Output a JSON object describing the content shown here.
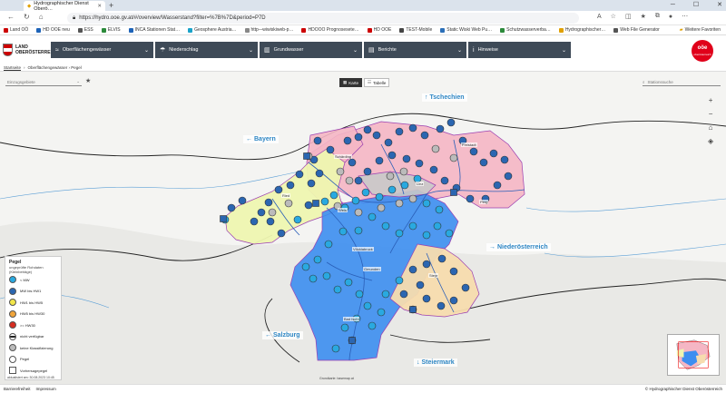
{
  "browser": {
    "tab_title": "Hydrographischer Dienst Oberö…",
    "url": "https://hydro.ooe.gv.at/#/overview/Wasserstand?filter=%7B%7D&period=P7D",
    "bookmarks": [
      "Land OÖ",
      "HD OOE neu",
      "ESS",
      "ELVIS",
      "INCA Stationen Stat…",
      "Geosphere Austria…",
      "http-–wiwiskiweb-p…",
      "HDOOO Prognosesete…",
      "HD OOE",
      "TEST-Mobile",
      "Static Wiski Web Pu…",
      "Schutzwasserverba…",
      "Hydrographischer…",
      "Web File Generator"
    ],
    "bookmarks_folder": "Weitere Favoriten"
  },
  "header": {
    "logo_line1": "LAND",
    "logo_line2": "OBERÖSTERREICH",
    "menus": [
      "Oberflächengewässer",
      "Niederschlag",
      "Grundwasser",
      "Berichte",
      "Hinweise"
    ],
    "ooe_logo_line1": "oöe",
    "ooe_logo_line2": "oberösterreich"
  },
  "breadcrumb": [
    "Startseite",
    "Oberflächengewässer › Pegel"
  ],
  "map": {
    "gebiet_placeholder": "Einzugsgebiete",
    "view_karte": "Karte",
    "view_tabelle": "Tabelle",
    "station_search_placeholder": "Stationssuche",
    "regions": [
      "Tschechien",
      "Bayern",
      "Niederösterreich",
      "Salzburg",
      "Steiermark"
    ],
    "towns": [
      "Schärding",
      "Ried",
      "Linz",
      "Freistadt",
      "Perg",
      "Vöcklabruck",
      "Gmunden",
      "Steyr",
      "Bad Ischl",
      "Wels"
    ],
    "attribution": "Grundkarte: basemap.at"
  },
  "legend": {
    "title": "Pegel",
    "subtitle": "ungeprüfte Rohdaten (Kleinbeträge)",
    "items": [
      {
        "label": "< MW",
        "color": "#29a9e0",
        "shape": "dot"
      },
      {
        "label": "MW bis HW1",
        "color": "#2b66b1",
        "shape": "dot"
      },
      {
        "label": "HW1 bis HW5",
        "color": "#f2e64a",
        "shape": "dot"
      },
      {
        "label": "HW5 bis HW30",
        "color": "#f0a43a",
        "shape": "dot"
      },
      {
        "label": ">= HW30",
        "color": "#d62d20",
        "shape": "dot"
      },
      {
        "label": "nicht verfügbar",
        "color": "#222222",
        "shape": "dot-line"
      },
      {
        "label": "keine Klassifizierung",
        "color": "#bbbbbb",
        "shape": "dot"
      },
      {
        "label": "Pegel",
        "color": "#ffffff",
        "shape": "dot"
      },
      {
        "label": "Vorhersagepegel",
        "color": "#ffffff",
        "shape": "square"
      }
    ],
    "updated": "aktualisiert am: 30.08.2023 10:45"
  },
  "footer": {
    "barrierefreiheit": "Barrierefreiheit",
    "impressum": "Impressum",
    "copyright": "© Hydrographischer Dienst Oberösterreich"
  }
}
